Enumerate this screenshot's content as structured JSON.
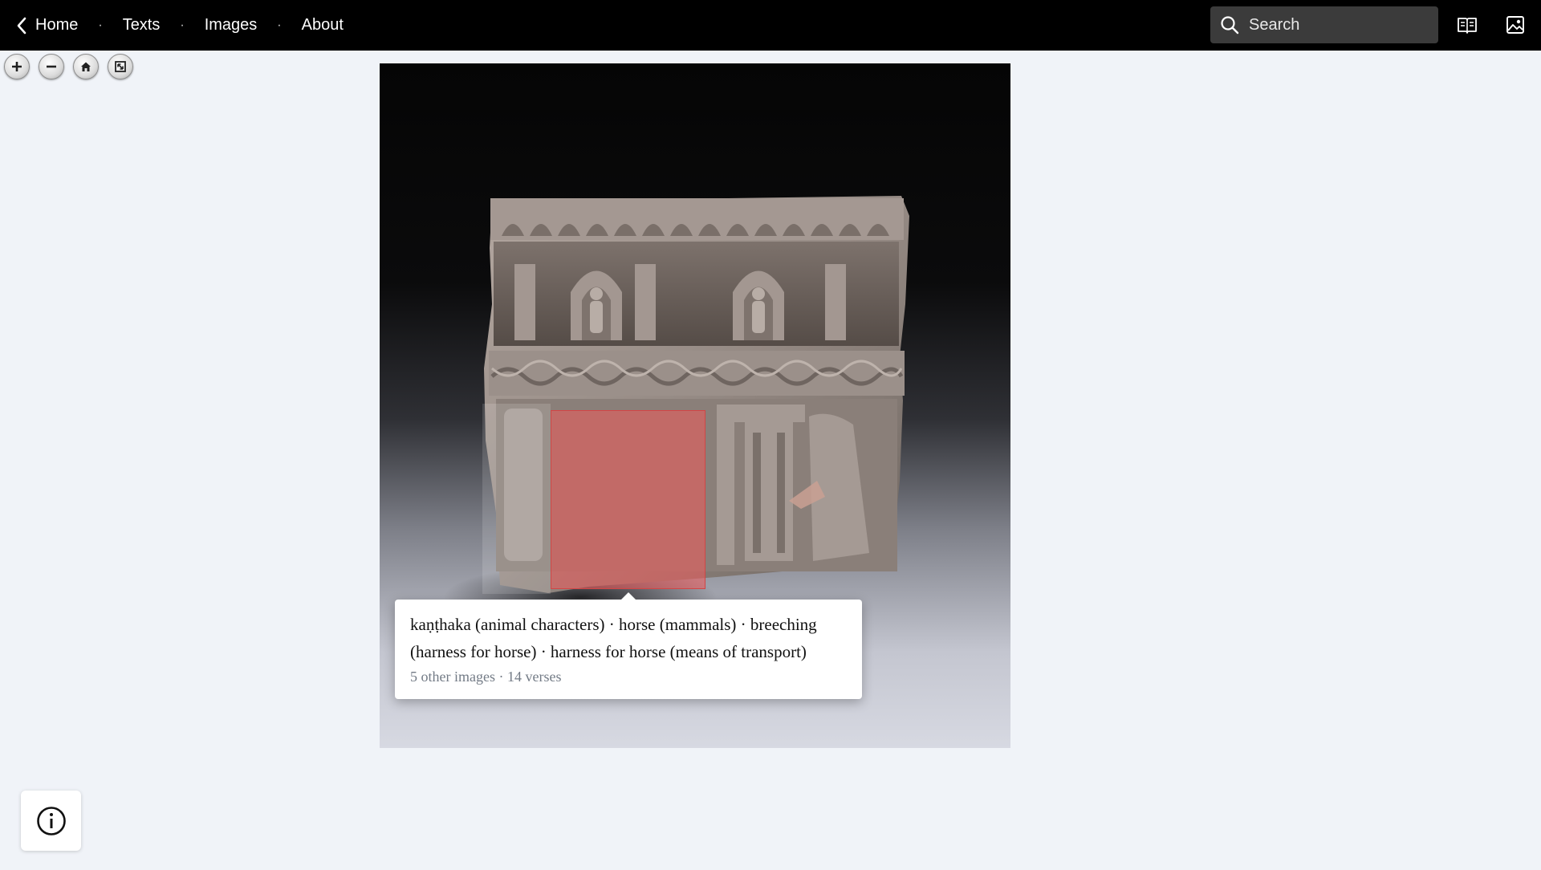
{
  "nav": {
    "back_label": "Home",
    "separator": "·",
    "links": [
      "Texts",
      "Images",
      "About"
    ]
  },
  "search": {
    "placeholder": "Search"
  },
  "header_icons": [
    "book-open-icon",
    "image-icon"
  ],
  "zoom_toolbar": [
    "zoom-in-icon",
    "zoom-out-icon",
    "home-icon",
    "fullscreen-icon"
  ],
  "annotation": {
    "title": "kaṇṭhaka (animal characters) · horse (mammals) · breeching (harness for horse) · harness for horse (means of transport)",
    "meta": "5 other images · 14 verses",
    "highlight_color": "#f05a5a"
  },
  "info_button": {
    "icon": "info-icon"
  },
  "colors": {
    "topbar": "#000000",
    "background": "#f0f3f8",
    "search_bg": "#3b3b3b"
  }
}
